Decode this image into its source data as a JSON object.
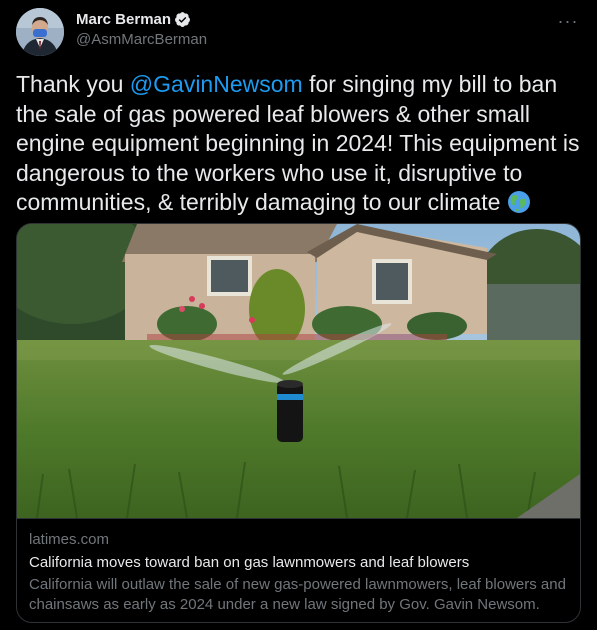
{
  "author": {
    "name": "Marc Berman",
    "handle": "@AsmMarcBerman"
  },
  "tweet": {
    "text_before": "Thank you ",
    "mention": "@GavinNewsom",
    "text_after": " for singing my bill to ban the sale of gas powered leaf blowers & other small engine equipment beginning in 2024! This equipment is dangerous to the workers who use it, disruptive to communities, & terribly damaging to our climate ",
    "emoji": "globe-emoji"
  },
  "card": {
    "domain": "latimes.com",
    "title": "California moves toward ban on gas lawnmowers and leaf blowers",
    "description": "California will outlaw the sale of new gas-powered lawnmowers, leaf blowers and chainsaws as early as 2024 under a new law signed by Gov. Gavin Newsom."
  },
  "icons": {
    "verified": "verified-badge-icon",
    "more": "more-options-icon"
  },
  "colors": {
    "background": "#000000",
    "text": "#e7e9ea",
    "secondary": "#71767b",
    "accent": "#1d9bf0",
    "border": "#2f3336"
  }
}
